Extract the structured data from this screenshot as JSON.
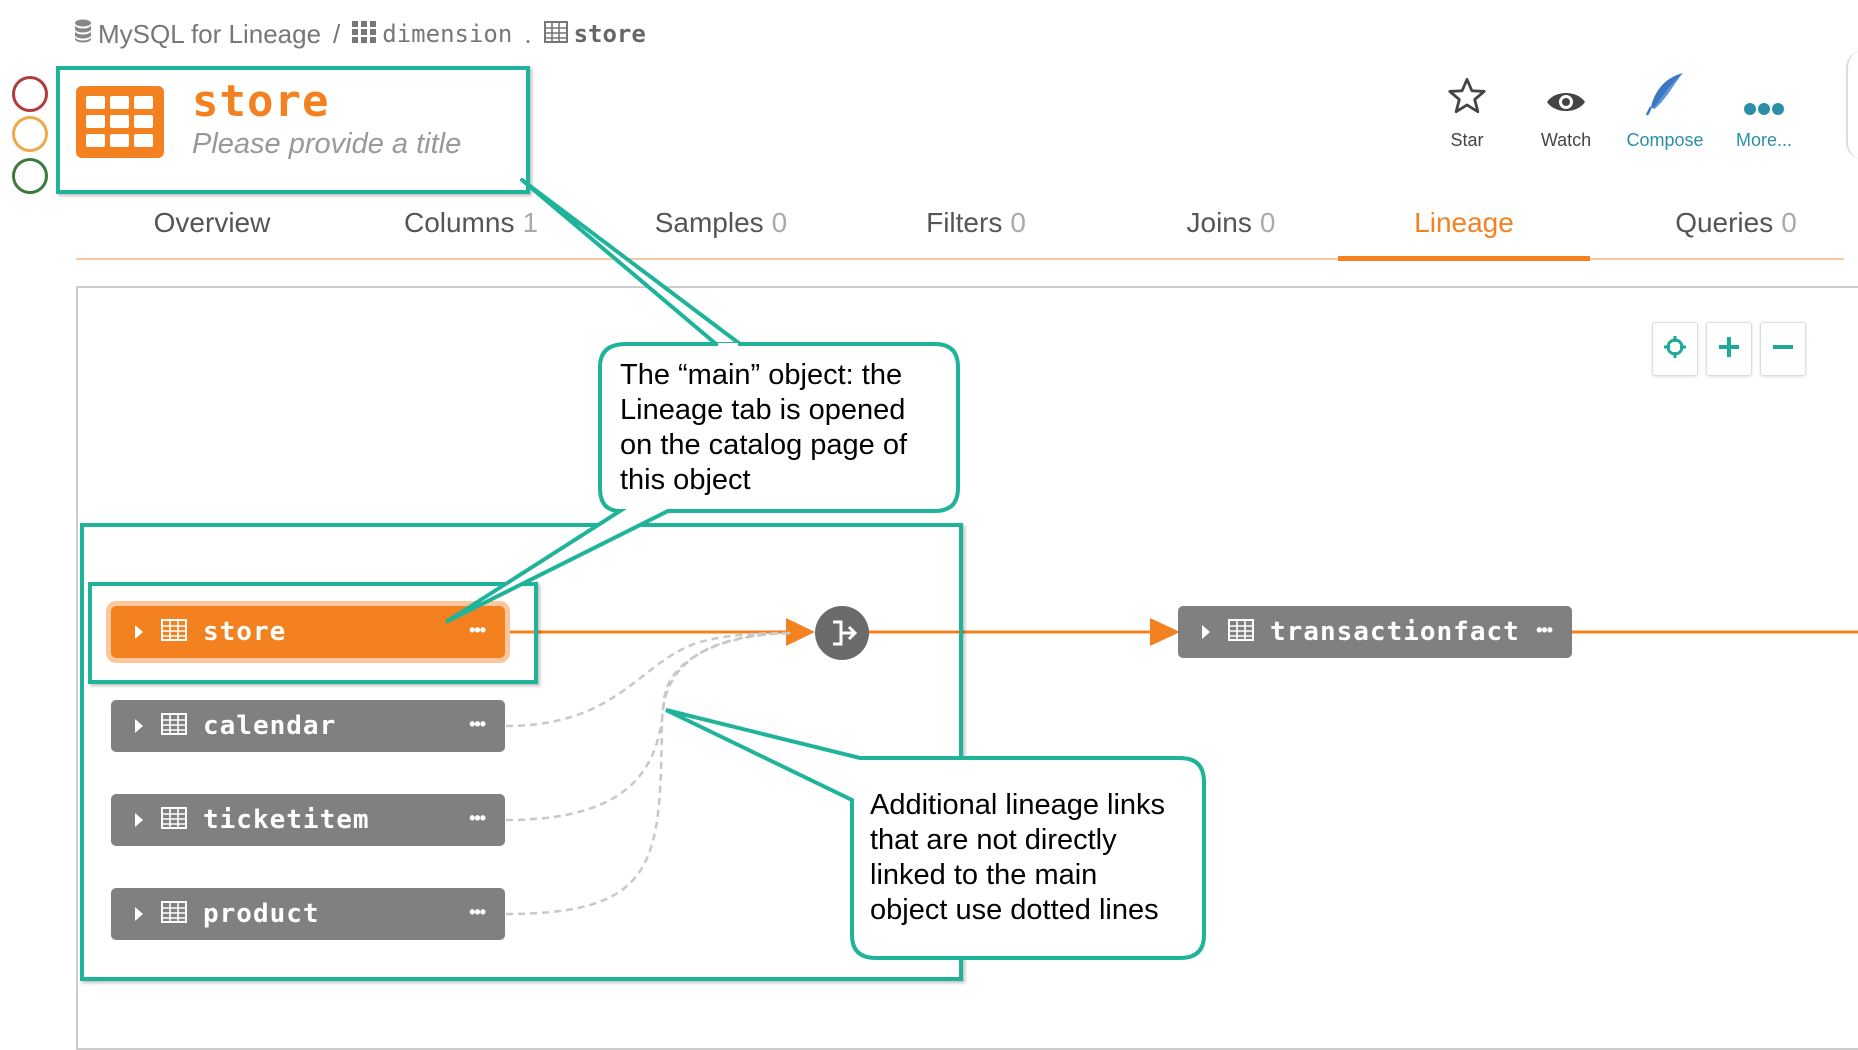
{
  "breadcrumb": {
    "source": "MySQL for Lineage",
    "separator": "/",
    "database": "dimension",
    "dot": ".",
    "table": "store"
  },
  "header": {
    "title": "store",
    "subtitle_placeholder": "Please provide a title"
  },
  "actions": [
    {
      "label": "Star",
      "icon": "star-icon"
    },
    {
      "label": "Watch",
      "icon": "eye-icon"
    },
    {
      "label": "Compose",
      "icon": "quill-icon"
    },
    {
      "label": "More...",
      "icon": "more-dots-icon"
    }
  ],
  "tabs": [
    {
      "label": "Overview",
      "count": ""
    },
    {
      "label": "Columns",
      "count": "1"
    },
    {
      "label": "Samples",
      "count": "0"
    },
    {
      "label": "Filters",
      "count": "0"
    },
    {
      "label": "Joins",
      "count": "0"
    },
    {
      "label": "Lineage",
      "count": ""
    },
    {
      "label": "Queries",
      "count": "0"
    }
  ],
  "active_tab": "Lineage",
  "lineage": {
    "main_node": "store",
    "other_sources": [
      "calendar",
      "ticketitem",
      "product"
    ],
    "target": "transactionfact",
    "more_glyph": "•••"
  },
  "annotations": {
    "main_object_callout": [
      "The “main” object: the",
      "Lineage tab is opened",
      "on the catalog page of",
      "this object"
    ],
    "dotted_callout": [
      "Additional lineage links",
      "that are not directly",
      "linked to the main",
      "object use dotted lines"
    ]
  },
  "colors": {
    "accent_orange": "#f48120",
    "node_gray": "#808080",
    "annotation_teal": "#1fb49a",
    "link_teal": "#2a8fa7"
  }
}
